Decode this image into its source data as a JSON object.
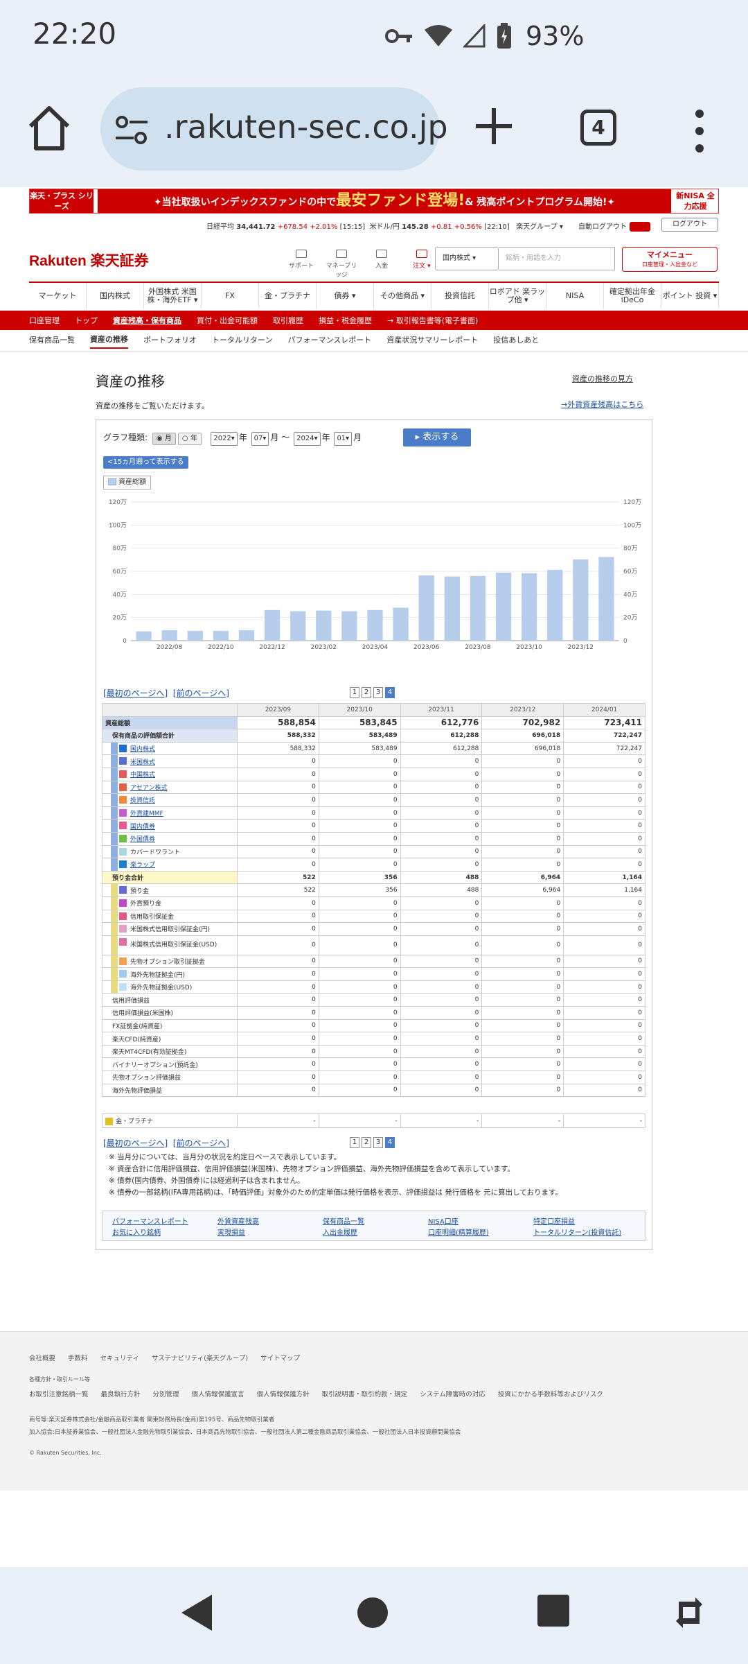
{
  "status": {
    "time": "22:20",
    "battery": "93%"
  },
  "browser": {
    "url": ".rakuten-sec.co.jp",
    "tab_count": "4"
  },
  "banner": {
    "left": "楽天・プラス シリーズ",
    "text_pre": "✦当社取扱いインデックスファンドの中で",
    "text_big": "最安ファンド登場!",
    "text_post": "& 残高ポイントプログラム開始!✦",
    "right": "新NISA 全力応援"
  },
  "market": {
    "nikkei_label": "日経平均",
    "nikkei_value": "34,441.72",
    "nikkei_change": "+678.54 +2.01%",
    "nikkei_time": "[15:15]",
    "usd_label": "米ドル/円",
    "usd_value": "145.28",
    "usd_change": "+0.81 +0.56%",
    "usd_time": "[22:10]",
    "group": "楽天グループ ▾",
    "auto_logout": "自動ログアウト",
    "logout": "ログアウト"
  },
  "header": {
    "logo": "Rakuten 楽天証券",
    "utils": [
      "サポート",
      "マネーブリッジ",
      "入金",
      "注文 ▾"
    ],
    "search_kind": "国内株式",
    "search_placeholder": "銘柄・用語を入力",
    "mymenu": "マイメニュー",
    "mymenu_sub": "口座管理・入出金など"
  },
  "global_nav": [
    "マーケット",
    "国内株式",
    "外国株式 米国株・海外ETF ▾",
    "FX",
    "金・プラチナ",
    "債券 ▾",
    "その他商品 ▾",
    "投資信託",
    "ロボアド 楽ラップ他 ▾",
    "NISA",
    "確定拠出年金 iDeCo",
    "ポイント 投資 ▾"
  ],
  "red_nav": [
    "口座管理",
    "トップ",
    "資産残高・保有商品",
    "買付・出金可能額",
    "取引履歴",
    "損益・税金履歴",
    "→ 取引報告書等(電子書面)"
  ],
  "sub_nav": [
    "保有商品一覧",
    "資産の推移",
    "ポートフォリオ",
    "トータルリターン",
    "パフォーマンスレポート",
    "資産状況サマリーレポート",
    "投信あしあと"
  ],
  "page": {
    "title": "資産の推移",
    "desc": "資産の推移をご覧いただけます。",
    "howto": "資産の推移の見方",
    "foreign_link": "→外貨資産残高はこちら"
  },
  "controls": {
    "graph_type_label": "グラフ種類:",
    "opt_month": "月",
    "opt_year": "年",
    "from_year": "2022",
    "from_month": "07",
    "to_year": "2024",
    "to_month": "01",
    "year_unit": "年",
    "month_unit": "月",
    "tilde": "〜",
    "show_button": "▸ 表示する",
    "back_15": "<15ヵ月遡って表示する",
    "legend": "資産総額"
  },
  "chart_data": {
    "type": "bar",
    "categories": [
      "2022/07",
      "2022/08",
      "2022/09",
      "2022/10",
      "2022/11",
      "2022/12",
      "2023/01",
      "2023/02",
      "2023/03",
      "2023/04",
      "2023/05",
      "2023/06",
      "2023/07",
      "2023/08",
      "2023/09",
      "2023/10",
      "2023/11",
      "2023/12",
      "2024/01"
    ],
    "tick_labels": [
      "2022/08",
      "2022/10",
      "2022/12",
      "2023/02",
      "2023/04",
      "2023/06",
      "2023/08",
      "2023/10",
      "2023/12"
    ],
    "series": [
      {
        "name": "資産総額",
        "values": [
          80000,
          90000,
          85000,
          85000,
          90000,
          265000,
          255000,
          260000,
          255000,
          265000,
          285000,
          565000,
          555000,
          560000,
          588854,
          583845,
          612776,
          702982,
          723411
        ]
      }
    ],
    "ylim": [
      0,
      1200000
    ],
    "yticks": [
      "0",
      "20万",
      "40万",
      "60万",
      "80万",
      "100万",
      "120万"
    ],
    "color": "#b7cdec"
  },
  "pager": {
    "first": "[最初のページへ]",
    "prev": "[前のページへ]",
    "pages": [
      "1",
      "2",
      "3",
      "4"
    ],
    "current": "4"
  },
  "table": {
    "columns": [
      "2023/09",
      "2023/10",
      "2023/11",
      "2023/12",
      "2024/01"
    ],
    "rows": [
      {
        "label": "資産総額",
        "values": [
          "588,854",
          "583,845",
          "612,776",
          "702,982",
          "723,411"
        ],
        "level": "total"
      },
      {
        "label": "保有商品の評価額合計",
        "values": [
          "588,332",
          "583,489",
          "612,288",
          "696,018",
          "722,247"
        ],
        "level": "sub"
      },
      {
        "label": "国内株式",
        "values": [
          "588,332",
          "583,489",
          "612,288",
          "696,018",
          "722,247"
        ],
        "level": "item",
        "color": "#1e6fd0",
        "link": true
      },
      {
        "label": "米国株式",
        "values": [
          "0",
          "0",
          "0",
          "0",
          "0"
        ],
        "level": "item",
        "color": "#5b6fd6",
        "link": true
      },
      {
        "label": "中国株式",
        "values": [
          "0",
          "0",
          "0",
          "0",
          "0"
        ],
        "level": "item",
        "color": "#e05a5a",
        "link": true
      },
      {
        "label": "アセアン株式",
        "values": [
          "0",
          "0",
          "0",
          "0",
          "0"
        ],
        "level": "item",
        "color": "#e0604a",
        "link": true
      },
      {
        "label": "投資信託",
        "values": [
          "0",
          "0",
          "0",
          "0",
          "0"
        ],
        "level": "item",
        "color": "#f08a3a",
        "link": true
      },
      {
        "label": "外貨建MMF",
        "values": [
          "0",
          "0",
          "0",
          "0",
          "0"
        ],
        "level": "item",
        "color": "#c25ed0",
        "link": true
      },
      {
        "label": "国内債券",
        "values": [
          "0",
          "0",
          "0",
          "0",
          "0"
        ],
        "level": "item",
        "color": "#e85a8a",
        "link": true
      },
      {
        "label": "外国債券",
        "values": [
          "0",
          "0",
          "0",
          "0",
          "0"
        ],
        "level": "item",
        "color": "#6cc04a",
        "link": true
      },
      {
        "label": "カバードワラント",
        "values": [
          "0",
          "0",
          "0",
          "0",
          "0"
        ],
        "level": "item",
        "color": "#a8d8e0",
        "link": false
      },
      {
        "label": "楽ラップ",
        "values": [
          "0",
          "0",
          "0",
          "0",
          "0"
        ],
        "level": "item",
        "color": "#1e7fd0",
        "link": true
      },
      {
        "label": "預り金合計",
        "values": [
          "522",
          "356",
          "488",
          "6,964",
          "1,164"
        ],
        "level": "sub2"
      },
      {
        "label": "預り金",
        "values": [
          "522",
          "356",
          "488",
          "6,964",
          "1,164"
        ],
        "level": "item",
        "color": "#6a6ad6",
        "link": false
      },
      {
        "label": "外貨預り金",
        "values": [
          "0",
          "0",
          "0",
          "0",
          "0"
        ],
        "level": "item",
        "color": "#c04ac8",
        "link": false
      },
      {
        "label": "信用取引保証金",
        "values": [
          "0",
          "0",
          "0",
          "0",
          "0"
        ],
        "level": "item",
        "color": "#e05a8a",
        "link": false
      },
      {
        "label": "米国株式信用取引保証金(円)",
        "values": [
          "0",
          "0",
          "0",
          "0",
          "0"
        ],
        "level": "item",
        "color": "#e0a0c0",
        "link": false
      },
      {
        "label": "米国株式信用取引保証金(USD)",
        "values": [
          "0",
          "0",
          "0",
          "0",
          "0"
        ],
        "level": "item2",
        "color": "#e070a0",
        "link": false
      },
      {
        "label": "先物オプション取引証拠金",
        "values": [
          "0",
          "0",
          "0",
          "0",
          "0"
        ],
        "level": "item",
        "color": "#f0a050",
        "link": false
      },
      {
        "label": "海外先物証拠金(円)",
        "values": [
          "0",
          "0",
          "0",
          "0",
          "0"
        ],
        "level": "item",
        "color": "#a0c8f0",
        "link": false
      },
      {
        "label": "海外先物証拠金(USD)",
        "values": [
          "0",
          "0",
          "0",
          "0",
          "0"
        ],
        "level": "item",
        "color": "#c0e0f8",
        "link": false
      },
      {
        "label": "信用評価損益",
        "values": [
          "0",
          "0",
          "0",
          "0",
          "0"
        ],
        "level": "plain"
      },
      {
        "label": "信用評価損益(米国株)",
        "values": [
          "0",
          "0",
          "0",
          "0",
          "0"
        ],
        "level": "plain"
      },
      {
        "label": "FX証拠金(純資産)",
        "values": [
          "0",
          "0",
          "0",
          "0",
          "0"
        ],
        "level": "plain"
      },
      {
        "label": "楽天CFD(純資産)",
        "values": [
          "0",
          "0",
          "0",
          "0",
          "0"
        ],
        "level": "plain"
      },
      {
        "label": "楽天MT4CFD(有効証拠金)",
        "values": [
          "0",
          "0",
          "0",
          "0",
          "0"
        ],
        "level": "plain"
      },
      {
        "label": "バイナリーオプション(預託金)",
        "values": [
          "0",
          "0",
          "0",
          "0",
          "0"
        ],
        "level": "plain"
      },
      {
        "label": "先物オプション評価損益",
        "values": [
          "0",
          "0",
          "0",
          "0",
          "0"
        ],
        "level": "plain"
      },
      {
        "label": "海外先物評価損益",
        "values": [
          "0",
          "0",
          "0",
          "0",
          "0"
        ],
        "level": "plain"
      }
    ],
    "gold": {
      "label": "金・プラチナ",
      "values": [
        "-",
        "-",
        "-",
        "-",
        "-"
      ],
      "color": "#e0c020"
    }
  },
  "notes": [
    "当月分については、当月分の状況を約定日ベースで表示しています。",
    "資産合計に信用評価損益、信用評価損益(米国株)、先物オプション評価損益、海外先物評価損益を含めて表示しています。",
    "債券(国内債券、外国債券)には経過利子は含まれません。",
    "債券の一部銘柄(IFA専用銘柄)は、「時価評価」対象外のため約定単価は発行価格を表示、評価損益は 発行価格を 元に算出しております。"
  ],
  "bottom_links": [
    "パフォーマンスレポート",
    "外貨資産残高",
    "保有商品一覧",
    "NISA口座",
    "特定口座損益",
    "お気に入り銘柄",
    "実現損益",
    "入出金履歴",
    "口座明細(精算履歴)",
    "トータルリターン(投資信託)"
  ],
  "footer": {
    "row1": [
      "会社概要",
      "手数料",
      "セキュリティ",
      "サステナビリティ(楽天グループ)",
      "サイトマップ"
    ],
    "small": "各種方針・取引ルール等",
    "row2": [
      "お取引注意銘柄一覧",
      "最良執行方針",
      "分別管理",
      "個人情報保護宣言",
      "個人情報保護方針",
      "取引説明書・取引約款・規定",
      "システム障害時の対応",
      "投資にかかる手数料等およびリスク"
    ],
    "company": "商号等:楽天証券株式会社/金融商品取引業者 関東財務局長(金商)第195号、商品先物取引業者",
    "assoc": "加入協会:日本証券業協会、一般社団法人金融先物取引業協会、日本商品先物取引協会、一般社団法人第二種金融商品取引業協会、一般社団法人日本投資顧問業協会",
    "copy": "© Rakuten Securities, Inc."
  }
}
